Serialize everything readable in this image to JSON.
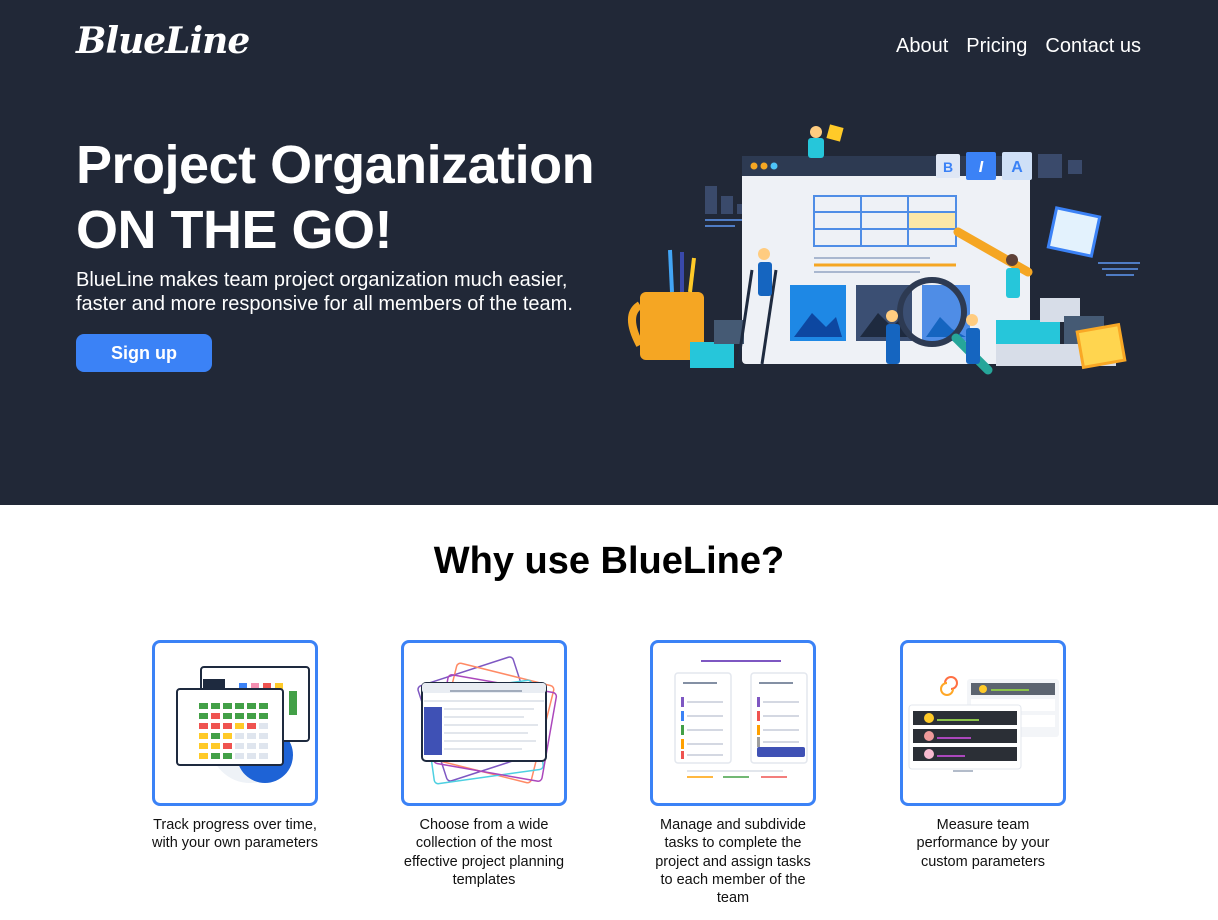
{
  "header": {
    "logo": "BlueLine",
    "nav": [
      "About",
      "Pricing",
      "Contact us"
    ]
  },
  "hero": {
    "title_line1": "Project Organization",
    "title_line2": "ON THE GO!",
    "subtitle": "BlueLine makes team project organization much easier, faster and more responsive for all members of the team.",
    "cta": "Sign up"
  },
  "why": {
    "title": "Why use BlueLine?",
    "features": [
      {
        "caption": "Track progress over time, with your own parameters",
        "icon": "progress-table-icon"
      },
      {
        "caption": "Choose from a wide collection of the most effective project planning templates",
        "icon": "templates-icon"
      },
      {
        "caption": "Manage and subdivide tasks to complete the project and assign tasks to each member of the team",
        "icon": "task-board-icon"
      },
      {
        "caption": "Measure team performance by your custom parameters",
        "icon": "leaderboard-icon"
      }
    ]
  },
  "colors": {
    "hero_bg": "#212837",
    "accent": "#3b82f6",
    "text_light": "#ffffff"
  }
}
